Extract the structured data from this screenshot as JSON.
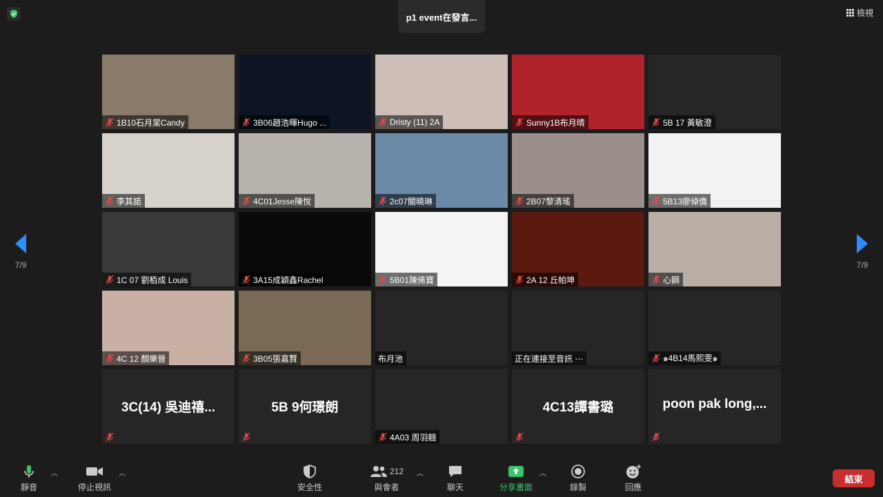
{
  "meeting": {
    "title": "p1 event在發言..."
  },
  "view_button": {
    "label": "檢視",
    "icon": "grid-icon"
  },
  "nav": {
    "left_page": "7/9",
    "right_page": "7/9"
  },
  "colors": {
    "accent_green": "#3cc46b",
    "mute_red": "#e04a4a",
    "end_red": "#c92e2e"
  },
  "participants": [
    {
      "name": "1B10石月棠Candy",
      "muted": true,
      "bg": "#8a7a6a"
    },
    {
      "name": "3B06趙浩暉Hugo ...",
      "muted": true,
      "bg": "#0d1524"
    },
    {
      "name": "Dristy (11) 2A",
      "muted": true,
      "bg": "#cdbfb8"
    },
    {
      "name": "Sunny1B布月晴",
      "muted": true,
      "bg": "#b1232b"
    },
    {
      "name": "5B 17 黃敏澄",
      "muted": true,
      "bg": "#262626"
    },
    {
      "name": "李其諾",
      "muted": true,
      "bg": "#d8d2cc"
    },
    {
      "name": "4C01Jesse陳悅",
      "muted": true,
      "bg": "#b9b3ad"
    },
    {
      "name": "2c07關曉琳",
      "muted": true,
      "bg": "#6b8aa8"
    },
    {
      "name": "2B07黎清瑤",
      "muted": true,
      "bg": "#9a8f8b"
    },
    {
      "name": "5B13廖倬僑",
      "muted": true,
      "bg": "#f2f2f2"
    },
    {
      "name": "1C 07 劉栢成 Louis",
      "muted": true,
      "bg": "#3a3a3a"
    },
    {
      "name": "3A15成穎鑫Rachel",
      "muted": true,
      "bg": "#0a0a0a"
    },
    {
      "name": "5B01陳俙寶",
      "muted": true,
      "bg": "#f4f4f4"
    },
    {
      "name": "2A 12 丘帕坤",
      "muted": true,
      "bg": "#5a1a10"
    },
    {
      "name": "心鋼",
      "muted": true,
      "bg": "#b8aea6"
    },
    {
      "name": "4C 12 顏樂晉",
      "muted": true,
      "bg": "#c9b0a4"
    },
    {
      "name": "3B05張嘉賢",
      "muted": true,
      "bg": "#7a6a55"
    },
    {
      "name": "布月池",
      "muted": false,
      "bg": "#262626"
    },
    {
      "name": "正在連接至音訊 ⋯",
      "muted": false,
      "bg": "#262626"
    },
    {
      "name": "๑4B14馬熙雯๑",
      "muted": true,
      "bg": "#262626"
    },
    {
      "name": "",
      "muted": true,
      "bg": "#262626",
      "bigname": "3C(14) 吳迪禧..."
    },
    {
      "name": "",
      "muted": true,
      "bg": "#262626",
      "bigname": "5B 9何璟朗"
    },
    {
      "name": "4A03 周羽翹",
      "muted": true,
      "bg": "#262626"
    },
    {
      "name": "",
      "muted": true,
      "bg": "#262626",
      "bigname": "4C13譚書璐"
    },
    {
      "name": "",
      "muted": true,
      "bg": "#262626",
      "bigname": "poon pak long,..."
    }
  ],
  "toolbar": {
    "mute": {
      "label": "靜音",
      "icon": "microphone-icon"
    },
    "video": {
      "label": "停止視訊",
      "icon": "video-camera-icon"
    },
    "security": {
      "label": "安全性",
      "icon": "shield-icon"
    },
    "participants": {
      "label": "與會者",
      "count": "212",
      "icon": "participants-icon"
    },
    "chat": {
      "label": "聊天",
      "icon": "chat-icon"
    },
    "share": {
      "label": "分享畫面",
      "icon": "share-screen-icon"
    },
    "record": {
      "label": "錄製",
      "icon": "record-icon"
    },
    "reactions": {
      "label": "回應",
      "icon": "emoji-icon"
    },
    "end": {
      "label": "結束"
    }
  }
}
